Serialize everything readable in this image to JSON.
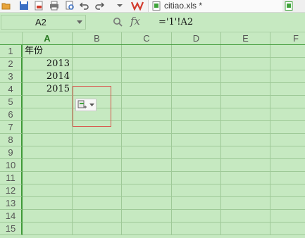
{
  "toolbar": {
    "tab_title": "citiao.xls *"
  },
  "formula_bar": {
    "name_box": "A2",
    "fx": "fx",
    "formula": "='1'!A2"
  },
  "columns": [
    "A",
    "B",
    "C",
    "D",
    "E",
    "F"
  ],
  "rows": [
    "1",
    "2",
    "3",
    "4",
    "5",
    "6",
    "7",
    "8",
    "9",
    "10",
    "11",
    "12",
    "13",
    "14",
    "15"
  ],
  "cells": {
    "A1": "年份",
    "A2": "2013",
    "A3": "2014",
    "A4": "2015"
  },
  "colors": {
    "sheet_bg": "#c6e9c1",
    "grid": "#9ec997",
    "accent": "#3f9a38",
    "popup_border": "#d9544c"
  }
}
